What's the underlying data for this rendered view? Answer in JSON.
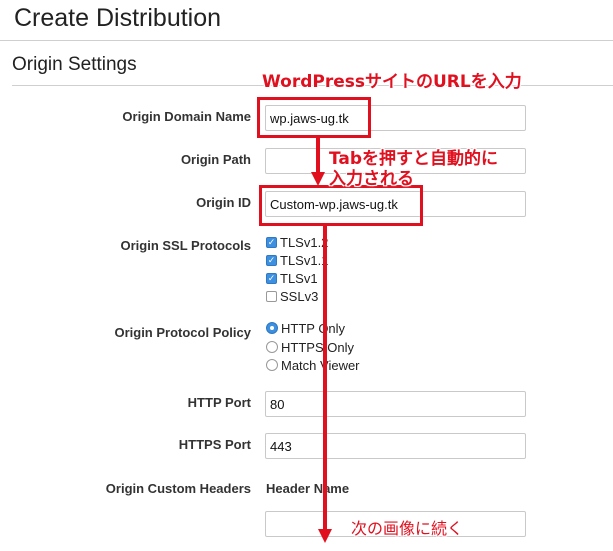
{
  "page": {
    "title": "Create Distribution"
  },
  "section": {
    "title": "Origin Settings"
  },
  "fields": {
    "origin_domain_name": {
      "label": "Origin Domain Name",
      "value": "wp.jaws-ug.tk"
    },
    "origin_path": {
      "label": "Origin Path",
      "value": ""
    },
    "origin_id": {
      "label": "Origin ID",
      "value": "Custom-wp.jaws-ug.tk"
    },
    "origin_ssl_protocols": {
      "label": "Origin SSL Protocols",
      "options": [
        {
          "label": "TLSv1.2",
          "checked": true
        },
        {
          "label": "TLSv1.1",
          "checked": true
        },
        {
          "label": "TLSv1",
          "checked": true
        },
        {
          "label": "SSLv3",
          "checked": false
        }
      ]
    },
    "origin_protocol_policy": {
      "label": "Origin Protocol Policy",
      "options": [
        {
          "label": "HTTP Only",
          "selected": true
        },
        {
          "label": "HTTPS Only",
          "selected": false
        },
        {
          "label": "Match Viewer",
          "selected": false
        }
      ]
    },
    "http_port": {
      "label": "HTTP Port",
      "value": "80"
    },
    "https_port": {
      "label": "HTTPS Port",
      "value": "443"
    },
    "origin_custom_headers": {
      "label": "Origin Custom Headers",
      "column_header": "Header Name",
      "value": ""
    }
  },
  "annotations": {
    "top_note": "WordPressサイトのURLを入力",
    "tab_note_line1": "Tabを押すと自動的に",
    "tab_note_line2": "入力される",
    "bottom_note": "次の画像に続く",
    "color": "#e0101f"
  }
}
